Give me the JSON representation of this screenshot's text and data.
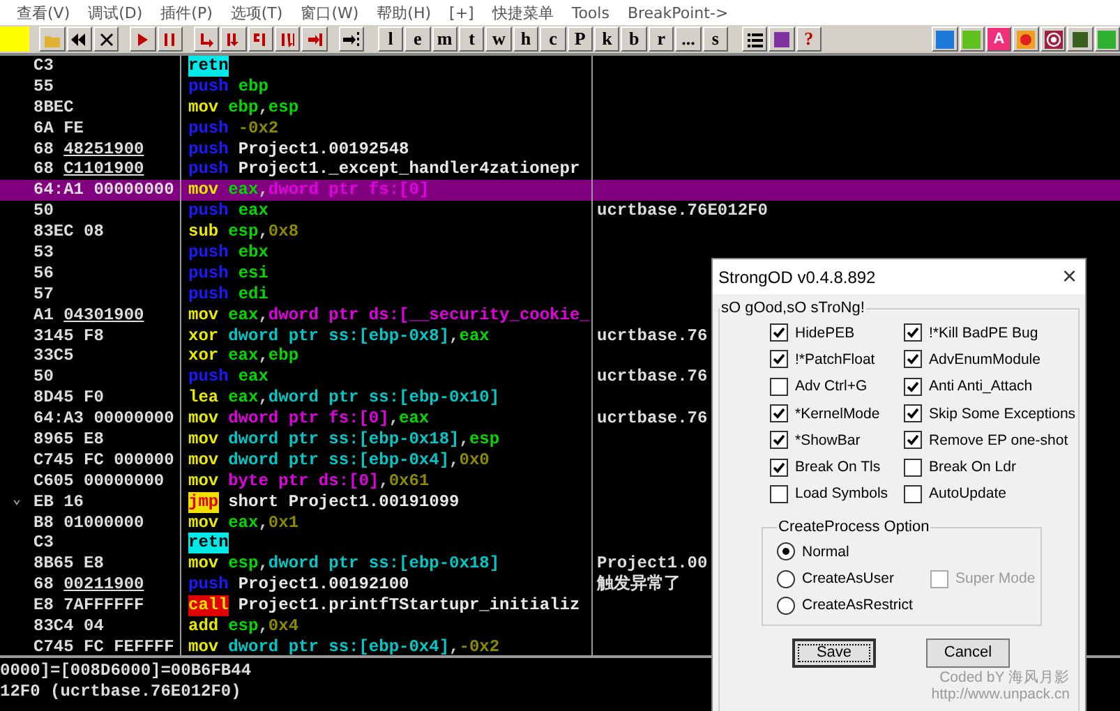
{
  "menu": [
    "查看(V)",
    "调试(D)",
    "插件(P)",
    "选项(T)",
    "窗口(W)",
    "帮助(H)",
    "[+]",
    "快捷菜单",
    "Tools",
    "BreakPoint->"
  ],
  "toolbar": {
    "letters": [
      "l",
      "e",
      "m",
      "t",
      "w",
      "h",
      "c",
      "P",
      "k",
      "b",
      "r",
      "...",
      "s"
    ],
    "help": "?",
    "lettered_tool": "A"
  },
  "rows": [
    {
      "bytes": "C3",
      "mn": "retn",
      "kind": "ret",
      "ops": [],
      "selected": false
    },
    {
      "bytes": "55",
      "mn": "push",
      "kind": "push",
      "ops": [
        {
          "t": "ebp",
          "kind": "reg"
        }
      ],
      "selected": false
    },
    {
      "bytes": "8BEC",
      "mn": "mov",
      "kind": "alu",
      "ops": [
        {
          "t": "ebp",
          "kind": "reg"
        },
        {
          "t": ",",
          "kind": "punct"
        },
        {
          "t": "esp",
          "kind": "reg"
        }
      ],
      "selected": false
    },
    {
      "bytes": "6A FE",
      "mn": "push",
      "kind": "push",
      "ops": [
        {
          "t": "-0x2",
          "kind": "imm"
        }
      ],
      "selected": false
    },
    {
      "bytes": "68",
      "ref": "48251900",
      "mn": "push",
      "kind": "push",
      "ops": [
        {
          "t": "Project1.00192548",
          "kind": "sym"
        }
      ],
      "selected": false
    },
    {
      "bytes": "68",
      "ref": "C1101900",
      "mn": "push",
      "kind": "push",
      "ops": [
        {
          "t": "Project1._except_handler4zationepr",
          "kind": "sym"
        }
      ],
      "selected": false
    },
    {
      "bytes": "64:A1 00000000",
      "mn": "mov",
      "kind": "alu",
      "ops": [
        {
          "t": "eax",
          "kind": "reg"
        },
        {
          "t": ",",
          "kind": "punct"
        },
        {
          "t": "dword ptr fs:[0]",
          "kind": "seg"
        }
      ],
      "selected": true
    },
    {
      "bytes": "50",
      "mn": "push",
      "kind": "push",
      "ops": [
        {
          "t": "eax",
          "kind": "reg"
        }
      ],
      "comment": "ucrtbase.76E012F0",
      "selected": false
    },
    {
      "bytes": "83EC 08",
      "mn": "sub",
      "kind": "alu",
      "ops": [
        {
          "t": "esp",
          "kind": "reg"
        },
        {
          "t": ",",
          "kind": "punct"
        },
        {
          "t": "0x8",
          "kind": "imm"
        }
      ],
      "selected": false
    },
    {
      "bytes": "53",
      "mn": "push",
      "kind": "push",
      "ops": [
        {
          "t": "ebx",
          "kind": "reg"
        }
      ],
      "selected": false
    },
    {
      "bytes": "56",
      "mn": "push",
      "kind": "push",
      "ops": [
        {
          "t": "esi",
          "kind": "reg"
        }
      ],
      "selected": false
    },
    {
      "bytes": "57",
      "mn": "push",
      "kind": "push",
      "ops": [
        {
          "t": "edi",
          "kind": "reg"
        }
      ],
      "selected": false
    },
    {
      "bytes": "A1",
      "ref": "04301900",
      "mn": "mov",
      "kind": "alu",
      "ops": [
        {
          "t": "eax",
          "kind": "reg"
        },
        {
          "t": ",",
          "kind": "punct"
        },
        {
          "t": "dword ptr ds:[__security_cookie_",
          "kind": "seg"
        }
      ],
      "selected": false
    },
    {
      "bytes": "3145 F8",
      "mn": "xor",
      "kind": "alu",
      "ops": [
        {
          "t": "dword ptr ss:[ebp-0x8]",
          "kind": "mem"
        },
        {
          "t": ",",
          "kind": "punct"
        },
        {
          "t": "eax",
          "kind": "reg"
        }
      ],
      "comment": "ucrtbase.76",
      "selected": false
    },
    {
      "bytes": "33C5",
      "mn": "xor",
      "kind": "alu",
      "ops": [
        {
          "t": "eax",
          "kind": "reg"
        },
        {
          "t": ",",
          "kind": "punct"
        },
        {
          "t": "ebp",
          "kind": "reg"
        }
      ],
      "selected": false
    },
    {
      "bytes": "50",
      "mn": "push",
      "kind": "push",
      "ops": [
        {
          "t": "eax",
          "kind": "reg"
        }
      ],
      "comment": "ucrtbase.76",
      "selected": false
    },
    {
      "bytes": "8D45 F0",
      "mn": "lea",
      "kind": "alu",
      "ops": [
        {
          "t": "eax",
          "kind": "reg"
        },
        {
          "t": ",",
          "kind": "punct"
        },
        {
          "t": "dword ptr ss:[ebp-0x10]",
          "kind": "mem"
        }
      ],
      "selected": false
    },
    {
      "bytes": "64:A3 00000000",
      "mn": "mov",
      "kind": "alu",
      "ops": [
        {
          "t": "dword ptr fs:[0]",
          "kind": "seg"
        },
        {
          "t": ",",
          "kind": "punct"
        },
        {
          "t": "eax",
          "kind": "reg"
        }
      ],
      "comment": "ucrtbase.76",
      "selected": false
    },
    {
      "bytes": "8965 E8",
      "mn": "mov",
      "kind": "alu",
      "ops": [
        {
          "t": "dword ptr ss:[ebp-0x18]",
          "kind": "mem"
        },
        {
          "t": ",",
          "kind": "punct"
        },
        {
          "t": "esp",
          "kind": "reg"
        }
      ],
      "selected": false
    },
    {
      "bytes": "C745 FC 000000",
      "mn": "mov",
      "kind": "alu",
      "ops": [
        {
          "t": "dword ptr ss:[ebp-0x4]",
          "kind": "mem"
        },
        {
          "t": ",",
          "kind": "punct"
        },
        {
          "t": "0x0",
          "kind": "imm"
        }
      ],
      "selected": false
    },
    {
      "bytes": "C605 00000000",
      "mn": "mov",
      "kind": "alu",
      "ops": [
        {
          "t": "byte ptr ds:[0]",
          "kind": "seg"
        },
        {
          "t": ",",
          "kind": "punct"
        },
        {
          "t": "0x61",
          "kind": "imm"
        }
      ],
      "selected": false
    },
    {
      "gutter": "⌄",
      "bytes": "EB 16",
      "mn": "jmp",
      "kind": "jmp",
      "ops": [
        {
          "t": "short Project1.00191099",
          "kind": "sym"
        }
      ],
      "selected": false
    },
    {
      "bytes": "B8 01000000",
      "mn": "mov",
      "kind": "alu",
      "ops": [
        {
          "t": "eax",
          "kind": "reg"
        },
        {
          "t": ",",
          "kind": "punct"
        },
        {
          "t": "0x1",
          "kind": "imm"
        }
      ],
      "selected": false
    },
    {
      "bytes": "C3",
      "mn": "retn",
      "kind": "ret",
      "ops": [],
      "selected": false
    },
    {
      "bytes": "8B65 E8",
      "mn": "mov",
      "kind": "alu",
      "ops": [
        {
          "t": "esp",
          "kind": "reg"
        },
        {
          "t": ",",
          "kind": "punct"
        },
        {
          "t": "dword ptr ss:[ebp-0x18]",
          "kind": "mem"
        }
      ],
      "comment": "Project1.00",
      "selected": false
    },
    {
      "bytes": "68",
      "ref": "00211900",
      "mn": "push",
      "kind": "push",
      "ops": [
        {
          "t": "Project1.00192100",
          "kind": "sym"
        }
      ],
      "comment": "触发异常了",
      "selected": false
    },
    {
      "bytes": "E8 7AFFFFFF",
      "mn": "call",
      "kind": "call",
      "ops": [
        {
          "t": "Project1.printfTStartupr_initializ",
          "kind": "sym"
        }
      ],
      "selected": false
    },
    {
      "bytes": "83C4 04",
      "mn": "add",
      "kind": "alu",
      "ops": [
        {
          "t": "esp",
          "kind": "reg"
        },
        {
          "t": ",",
          "kind": "punct"
        },
        {
          "t": "0x4",
          "kind": "imm"
        }
      ],
      "selected": false
    },
    {
      "bytes": "C745 FC FEFFFF",
      "mn": "mov",
      "kind": "alu",
      "ops": [
        {
          "t": "dword ptr ss:[ebp-0x4]",
          "kind": "mem"
        },
        {
          "t": ",",
          "kind": "punct"
        },
        {
          "t": "-0x2",
          "kind": "imm"
        }
      ],
      "selected": false
    }
  ],
  "info_pane": [
    "0000]=[008D6000]=00B6FB44",
    "12F0 (ucrtbase.76E012F0)"
  ],
  "dialog": {
    "title": "StrongOD v0.4.8.892",
    "close": "×",
    "group": "sO gOod,sO sTroNg!",
    "options_left": [
      {
        "label": "HidePEB",
        "checked": true
      },
      {
        "label": "!*PatchFloat",
        "checked": true
      },
      {
        "label": "Adv Ctrl+G",
        "checked": false
      },
      {
        "label": "*KernelMode",
        "checked": true
      },
      {
        "label": "*ShowBar",
        "checked": true
      },
      {
        "label": "Break On Tls",
        "checked": true
      },
      {
        "label": "Load Symbols",
        "checked": false
      }
    ],
    "options_right": [
      {
        "label": "!*Kill BadPE Bug",
        "checked": true
      },
      {
        "label": "AdvEnumModule",
        "checked": true
      },
      {
        "label": "Anti Anti_Attach",
        "checked": true
      },
      {
        "label": "Skip Some Exceptions",
        "checked": true
      },
      {
        "label": "Remove EP one-shot",
        "checked": true
      },
      {
        "label": "Break On Ldr",
        "checked": false
      },
      {
        "label": "AutoUpdate",
        "checked": false
      }
    ],
    "process_group": "CreateProcess Option",
    "process_options": [
      {
        "label": "Normal",
        "selected": true
      },
      {
        "label": "CreateAsUser",
        "selected": false
      },
      {
        "label": "CreateAsRestrict",
        "selected": false
      }
    ],
    "super_mode": {
      "label": "Super Mode",
      "checked": false,
      "disabled": true
    },
    "buttons": [
      {
        "label": "Save",
        "focused": true
      },
      {
        "label": "Cancel",
        "focused": false
      }
    ],
    "credit": "Coded bY 海风月影",
    "url": "http://www.unpack.cn"
  }
}
